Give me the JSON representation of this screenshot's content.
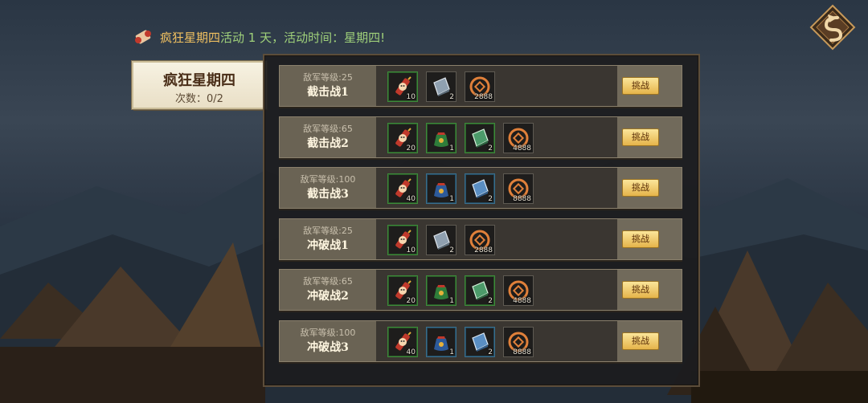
{
  "header": {
    "event_name": "疯狂星期四",
    "message": "活动 1 天，活动时间：星期四!",
    "icon": "scroll-icon"
  },
  "back_button_icon": "back-arrow-icon",
  "event_card": {
    "title": "疯狂星期四",
    "count": "次数：0/2"
  },
  "battles": [
    {
      "level": "敌军等级:25",
      "name": "截击战1",
      "button": "挑战",
      "rewards": [
        {
          "icon": "firecracker-icon",
          "qty": "10",
          "rarity": "green"
        },
        {
          "icon": "gray-book-icon",
          "qty": "2",
          "rarity": "gray"
        },
        {
          "icon": "coin-icon",
          "qty": "2888",
          "rarity": "gray"
        }
      ]
    },
    {
      "level": "敌军等级:65",
      "name": "截击战2",
      "button": "挑战",
      "rewards": [
        {
          "icon": "firecracker-icon",
          "qty": "20",
          "rarity": "green"
        },
        {
          "icon": "green-bag-icon",
          "qty": "1",
          "rarity": "green"
        },
        {
          "icon": "green-book-icon",
          "qty": "2",
          "rarity": "green"
        },
        {
          "icon": "coin-icon",
          "qty": "4888",
          "rarity": "gray"
        }
      ]
    },
    {
      "level": "敌军等级:100",
      "name": "截击战3",
      "button": "挑战",
      "rewards": [
        {
          "icon": "firecracker-icon",
          "qty": "40",
          "rarity": "green"
        },
        {
          "icon": "blue-bag-icon",
          "qty": "1",
          "rarity": "blue"
        },
        {
          "icon": "blue-book-icon",
          "qty": "2",
          "rarity": "blue"
        },
        {
          "icon": "coin-icon",
          "qty": "8888",
          "rarity": "gray"
        }
      ]
    },
    {
      "level": "敌军等级:25",
      "name": "冲破战1",
      "button": "挑战",
      "rewards": [
        {
          "icon": "firecracker-icon",
          "qty": "10",
          "rarity": "green"
        },
        {
          "icon": "gray-book-icon",
          "qty": "2",
          "rarity": "gray"
        },
        {
          "icon": "coin-icon",
          "qty": "2888",
          "rarity": "gray"
        }
      ]
    },
    {
      "level": "敌军等级:65",
      "name": "冲破战2",
      "button": "挑战",
      "rewards": [
        {
          "icon": "firecracker-icon",
          "qty": "20",
          "rarity": "green"
        },
        {
          "icon": "green-bag-icon",
          "qty": "1",
          "rarity": "green"
        },
        {
          "icon": "green-book-icon",
          "qty": "2",
          "rarity": "green"
        },
        {
          "icon": "coin-icon",
          "qty": "4888",
          "rarity": "gray"
        }
      ]
    },
    {
      "level": "敌军等级:100",
      "name": "冲破战3",
      "button": "挑战",
      "rewards": [
        {
          "icon": "firecracker-icon",
          "qty": "40",
          "rarity": "green"
        },
        {
          "icon": "blue-bag-icon",
          "qty": "1",
          "rarity": "blue"
        },
        {
          "icon": "blue-book-icon",
          "qty": "2",
          "rarity": "blue"
        },
        {
          "icon": "coin-icon",
          "qty": "8888",
          "rarity": "gray"
        }
      ]
    }
  ],
  "colors": {
    "accent_gold": "#f0c060",
    "accent_green": "#9fd07a"
  }
}
